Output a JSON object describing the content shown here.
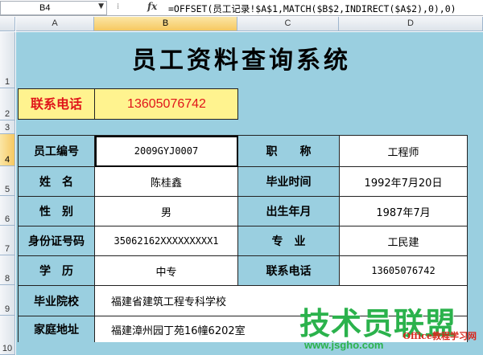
{
  "formula_bar": {
    "name_box": "B4",
    "fx": "fx",
    "formula": "=OFFSET(员工记录!$A$1,MATCH($B$2,INDIRECT($A$2),0),0)"
  },
  "columns": [
    "A",
    "B",
    "C",
    "D"
  ],
  "rows": [
    "1",
    "2",
    "3",
    "4",
    "5",
    "6",
    "7",
    "8",
    "9",
    "10"
  ],
  "sheet": {
    "title": "员工资料查询系统",
    "contact": {
      "label": "联系电话",
      "value": "13605076742"
    },
    "table": {
      "emp_no_label": "员工编号",
      "emp_no": "2009GYJ0007",
      "title_label": "职　　称",
      "title_value": "工程师",
      "name_label": "姓　名",
      "name": "陈桂鑫",
      "grad_time_label": "毕业时间",
      "grad_time": "1992年7月20日",
      "gender_label": "性　别",
      "gender": "男",
      "birth_label": "出生年月",
      "birth": "1987年7月",
      "id_label": "身份证号码",
      "id_value": "35062162XXXXXXXXX1",
      "major_label": "专　业",
      "major": "工民建",
      "edu_label": "学　历",
      "edu": "中专",
      "phone_label": "联系电话",
      "phone": "13605076742",
      "school_label": "毕业院校",
      "school": "福建省建筑工程专科学校",
      "address_label": "家庭地址",
      "address": "福建漳州园丁苑16幢6202室"
    }
  },
  "watermark": {
    "main": "技术员联盟",
    "sub": "Office教程学习网",
    "url": "www.jsgho.com"
  },
  "colors": {
    "sheet_bg": "#9acfe0",
    "contact_bg": "#fff38f",
    "contact_text": "#e0151a"
  }
}
